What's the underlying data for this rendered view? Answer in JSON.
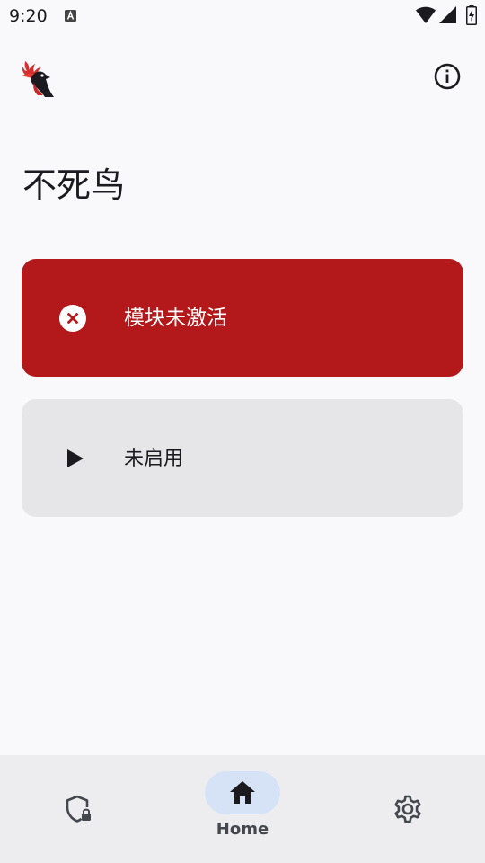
{
  "status_bar": {
    "time": "9:20"
  },
  "header": {
    "logo_icon": "phoenix-bird-logo",
    "info_icon": "info-icon"
  },
  "main": {
    "title": "不死鸟",
    "module_status": {
      "label": "模块未激活",
      "icon": "error-circle-icon",
      "color": "#b3191a"
    },
    "enable_toggle": {
      "label": "未启用",
      "icon": "play-icon"
    }
  },
  "bottom_nav": {
    "items": [
      {
        "icon": "shield-lock-icon",
        "label": ""
      },
      {
        "icon": "home-icon",
        "label": "Home",
        "selected": true
      },
      {
        "icon": "gear-icon",
        "label": ""
      }
    ]
  }
}
